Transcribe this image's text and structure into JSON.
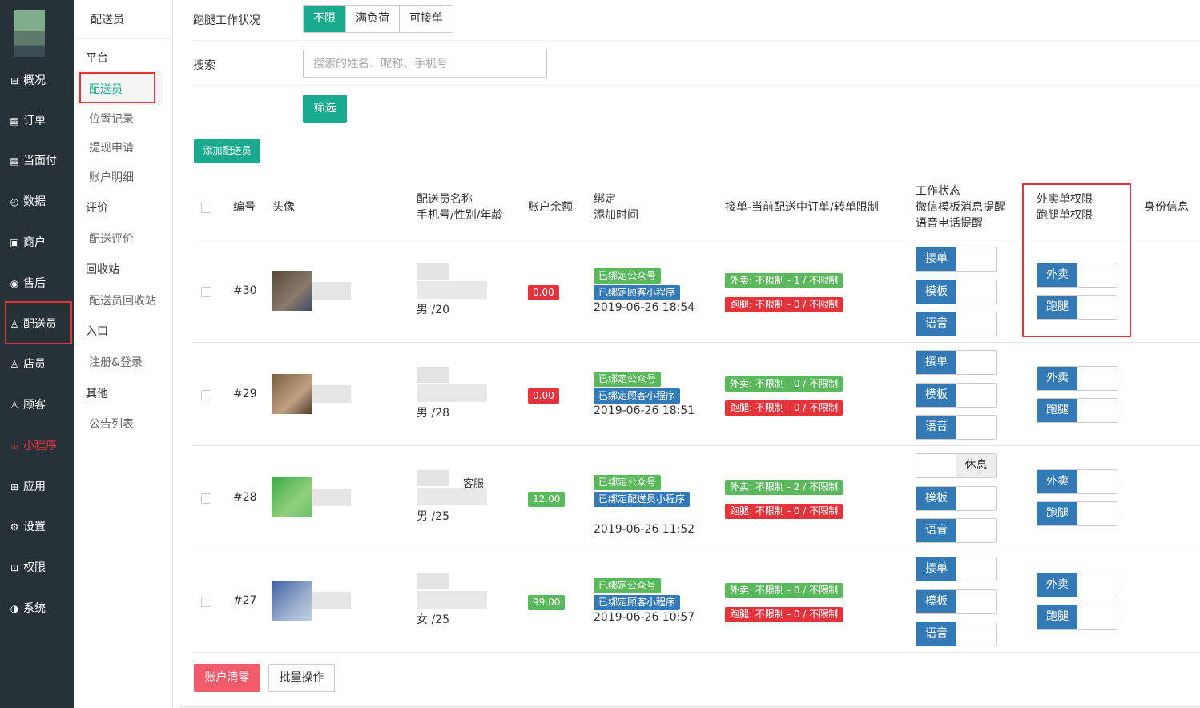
{
  "sidebar": {
    "items": [
      {
        "icon": "dashboard-icon",
        "glyph": "⊟",
        "label": "概况"
      },
      {
        "icon": "order-icon",
        "glyph": "▤",
        "label": "订单"
      },
      {
        "icon": "pay-icon",
        "glyph": "▤",
        "label": "当面付"
      },
      {
        "icon": "data-icon",
        "glyph": "◴",
        "label": "数据"
      },
      {
        "icon": "shop-icon",
        "glyph": "▣",
        "label": "商户"
      },
      {
        "icon": "aftersale-icon",
        "glyph": "◉",
        "label": "售后"
      },
      {
        "icon": "courier-icon",
        "glyph": "♙",
        "label": "配送员"
      },
      {
        "icon": "clerk-icon",
        "glyph": "♙",
        "label": "店员"
      },
      {
        "icon": "customer-icon",
        "glyph": "♙",
        "label": "顾客"
      },
      {
        "icon": "miniprogram-icon",
        "glyph": "∞",
        "label": "小程序"
      },
      {
        "icon": "apps-icon",
        "glyph": "⊞",
        "label": "应用"
      },
      {
        "icon": "settings-icon",
        "glyph": "⚙",
        "label": "设置"
      },
      {
        "icon": "lock-icon",
        "glyph": "⊡",
        "label": "权限"
      },
      {
        "icon": "system-icon",
        "glyph": "◑",
        "label": "系统"
      }
    ]
  },
  "submenu": {
    "title": "配送员",
    "groups": [
      {
        "label": "平台",
        "items": [
          "配送员",
          "位置记录",
          "提现申请",
          "账户明细"
        ]
      },
      {
        "label": "评价",
        "items": [
          "配送评价"
        ]
      },
      {
        "label": "回收站",
        "items": [
          "配送员回收站"
        ]
      },
      {
        "label": "入口",
        "items": [
          "注册&登录"
        ]
      },
      {
        "label": "其他",
        "items": [
          "公告列表"
        ]
      }
    ]
  },
  "filter": {
    "status_label": "跑腿工作状况",
    "status_options": [
      "不限",
      "满负荷",
      "可接单"
    ],
    "search_label": "搜索",
    "search_placeholder": "搜索的姓名、昵称、手机号",
    "filter_button": "筛选",
    "add_button": "添加配送员"
  },
  "table": {
    "headers": {
      "id": "编号",
      "avatar": "头像",
      "name1": "配送员名称",
      "name2": "手机号/性别/年龄",
      "balance": "账户余额",
      "bind1": "绑定",
      "bind2": "添加时间",
      "orders": "接单-当前配送中订单/转单限制",
      "work1": "工作状态",
      "work2": "微信模板消息提醒",
      "work3": "语音电话提醒",
      "perm1": "外卖单权限",
      "perm2": "跑腿单权限",
      "identity": "身份信息"
    },
    "rows": [
      {
        "id": "#30",
        "name_extra": "",
        "gender_age": "男 /20",
        "balance": "0.00",
        "balance_color": "#e5333b",
        "bind1": "已绑定公众号",
        "bind2": "已绑定顾客小程序",
        "time": "2019-06-26 18:54",
        "waimai": "外卖:  不限制 - 1 / 不限制",
        "paotui": "跑腿:  不限制 - 0 / 不限制",
        "work": {
          "label": "接单",
          "on": true
        },
        "tpl": "模板",
        "voice": "语音",
        "perm_waimai": "外卖",
        "perm_paotui": "跑腿"
      },
      {
        "id": "#29",
        "name_extra": "",
        "gender_age": "男 /28",
        "balance": "0.00",
        "balance_color": "#e5333b",
        "bind1": "已绑定公众号",
        "bind2": "已绑定顾客小程序",
        "time": "2019-06-26 18:51",
        "waimai": "外卖:  不限制 - 0 / 不限制",
        "paotui": "跑腿:  不限制 - 0 / 不限制",
        "work": {
          "label": "接单",
          "on": true
        },
        "tpl": "模板",
        "voice": "语音",
        "perm_waimai": "外卖",
        "perm_paotui": "跑腿"
      },
      {
        "id": "#28",
        "name_extra": "客服",
        "gender_age": "男 /25",
        "balance": "12.00",
        "balance_color": "#5cb85c",
        "bind1": "已绑定公众号",
        "bind2": "已绑定配送员小程序",
        "time": "2019-06-26 11:52",
        "waimai": "外卖:  不限制 - 2 / 不限制",
        "paotui": "跑腿:  不限制 - 0 / 不限制",
        "work": {
          "label": "休息",
          "on": false
        },
        "tpl": "模板",
        "voice": "语音",
        "perm_waimai": "外卖",
        "perm_paotui": "跑腿"
      },
      {
        "id": "#27",
        "name_extra": "",
        "gender_age": "女 /25",
        "balance": "99.00",
        "balance_color": "#5cb85c",
        "bind1": "已绑定公众号",
        "bind2": "已绑定顾客小程序",
        "time": "2019-06-26 10:57",
        "waimai": "外卖:  不限制 - 0 / 不限制",
        "paotui": "跑腿:  不限制 - 0 / 不限制",
        "work": {
          "label": "接单",
          "on": true
        },
        "tpl": "模板",
        "voice": "语音",
        "perm_waimai": "外卖",
        "perm_paotui": "跑腿"
      }
    ]
  },
  "footer": {
    "clear_button": "账户清零",
    "batch_button": "批量操作"
  },
  "colors": {
    "accent": "#1aaa8e",
    "sidebar_bg": "#263238",
    "highlight_red": "#e5333b",
    "tag_green": "#5cb85c",
    "tag_blue": "#337ab7"
  }
}
